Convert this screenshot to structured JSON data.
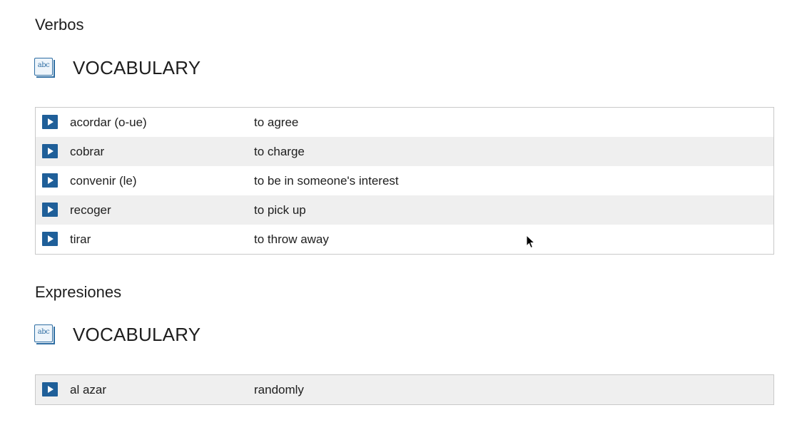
{
  "sections": [
    {
      "heading": "Verbos",
      "vocab_label": "VOCABULARY",
      "icon_text": "abc",
      "rows": [
        {
          "term": "acordar (o-ue)",
          "meaning": "to agree"
        },
        {
          "term": "cobrar",
          "meaning": "to charge"
        },
        {
          "term": "convenir (le)",
          "meaning": "to be in someone's interest"
        },
        {
          "term": "recoger",
          "meaning": "to pick up"
        },
        {
          "term": "tirar",
          "meaning": "to throw away"
        }
      ]
    },
    {
      "heading": "Expresiones",
      "vocab_label": "VOCABULARY",
      "icon_text": "abc",
      "rows": [
        {
          "term": "al azar",
          "meaning": "randomly"
        }
      ]
    }
  ],
  "colors": {
    "play_button": "#1f5f99",
    "alt_row": "#efefef",
    "table_border": "#c9c9c9"
  },
  "icons": {
    "vocab": "vocabulary-book-icon",
    "play": "play-audio-icon",
    "cursor": "mouse-pointer-icon"
  }
}
